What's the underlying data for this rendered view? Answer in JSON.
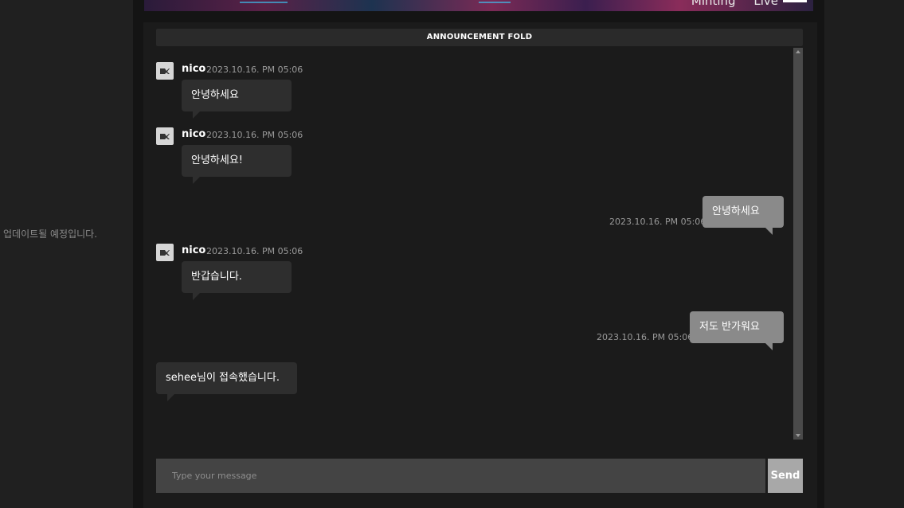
{
  "sidebar": {
    "notice": "업데이트될 예정입니다."
  },
  "header": {
    "nav": [
      "Minting",
      "Live"
    ]
  },
  "announcement": {
    "label": "ANNOUNCEMENT FOLD"
  },
  "messages": [
    {
      "sender": "nico",
      "time": "2023.10.16. PM 05:06",
      "text": "안녕하세요",
      "mine": false
    },
    {
      "sender": "nico",
      "time": "2023.10.16. PM 05:06",
      "text": "안녕하세요!",
      "mine": false
    },
    {
      "sender": "",
      "time": "2023.10.16. PM 05:06",
      "text": "안녕하세요",
      "mine": true
    },
    {
      "sender": "nico",
      "time": "2023.10.16. PM 05:06",
      "text": "반갑습니다.",
      "mine": false
    },
    {
      "sender": "",
      "time": "2023.10.16. PM 05:06",
      "text": "저도 반가워요",
      "mine": true
    }
  ],
  "system_message": "sehee님이 접속했습니다.",
  "composer": {
    "placeholder": "Type your message",
    "send_label": "Send"
  },
  "colors": {
    "bubble_other": "#2e2e2e",
    "bubble_mine": "#8a8a8a",
    "send_button": "#a8a8a8"
  }
}
